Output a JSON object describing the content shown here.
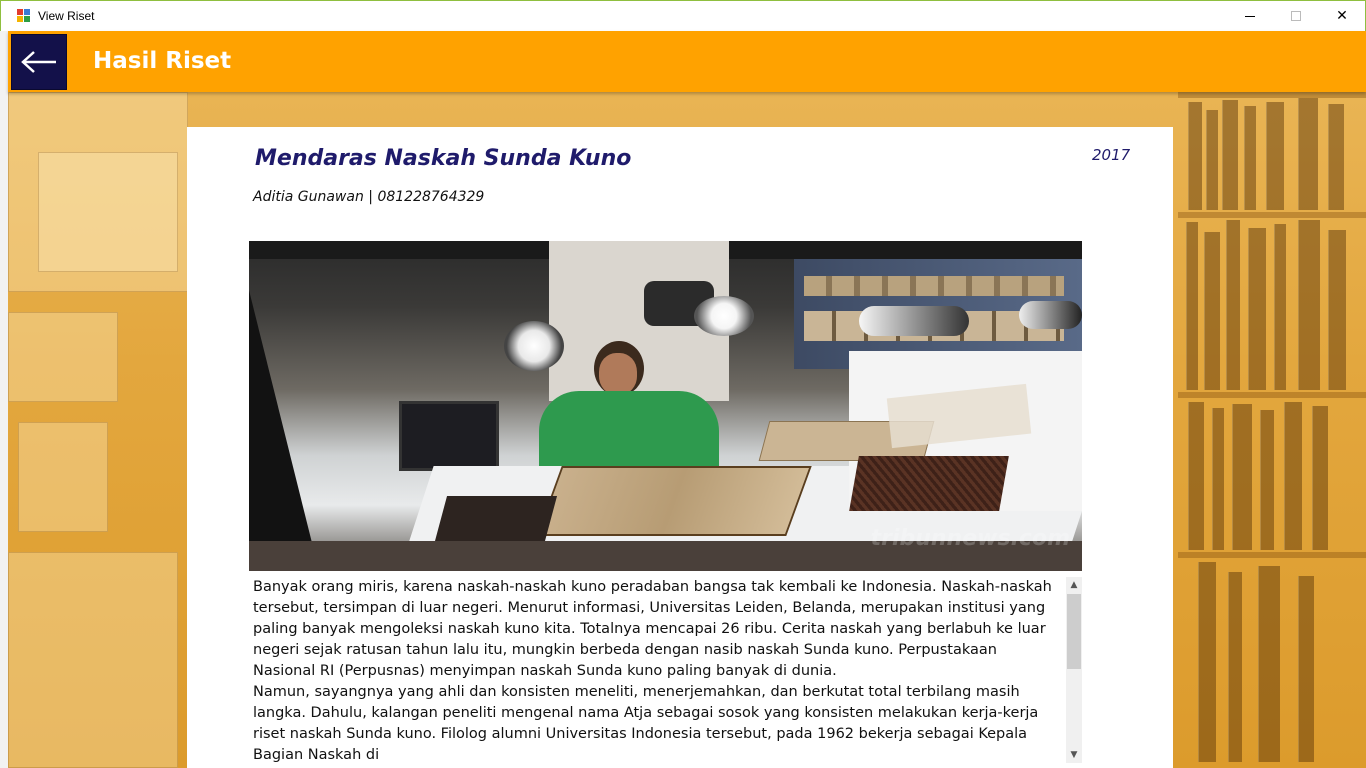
{
  "window": {
    "title": "View Riset",
    "minimize_glyph": "–",
    "maximize_glyph": "☐",
    "close_glyph": "✕"
  },
  "header": {
    "back_icon": "arrow-left-icon",
    "title": "Hasil Riset",
    "color": "#ffa200",
    "back_button_color": "#13114a"
  },
  "research": {
    "title": "Mendaras Naskah Sunda Kuno",
    "year": "2017",
    "author": "Aditia Gunawan | 081228764329",
    "paragraphs": [
      "Banyak orang miris, karena naskah-naskah kuno peradaban bangsa tak kembali ke Indonesia. Naskah-naskah tersebut, tersimpan di luar negeri. Menurut informasi, Universitas Leiden, Belanda, merupakan institusi yang paling banyak mengoleksi naskah kuno kita. Totalnya mencapai 26 ribu. Cerita naskah yang berlabuh ke luar negeri sejak ratusan tahun lalu itu, mungkin berbeda dengan nasib naskah Sunda kuno. Perpustakaan Nasional RI (Perpusnas) menyimpan naskah Sunda kuno paling banyak di dunia.",
      "Namun, sayangnya yang ahli dan konsisten meneliti, menerjemahkan, dan berkutat total terbilang masih langka. Dahulu, kalangan peneliti mengenal nama Atja sebagai sosok yang konsisten melakukan kerja-kerja riset naskah Sunda kuno. Filolog alumni Universitas Indonesia tersebut, pada 1962 bekerja sebagai Kepala Bagian Naskah di"
    ]
  },
  "photo": {
    "watermark": "tribunnews.com"
  },
  "scrollbar": {
    "up_glyph": "▲",
    "down_glyph": "▼"
  }
}
